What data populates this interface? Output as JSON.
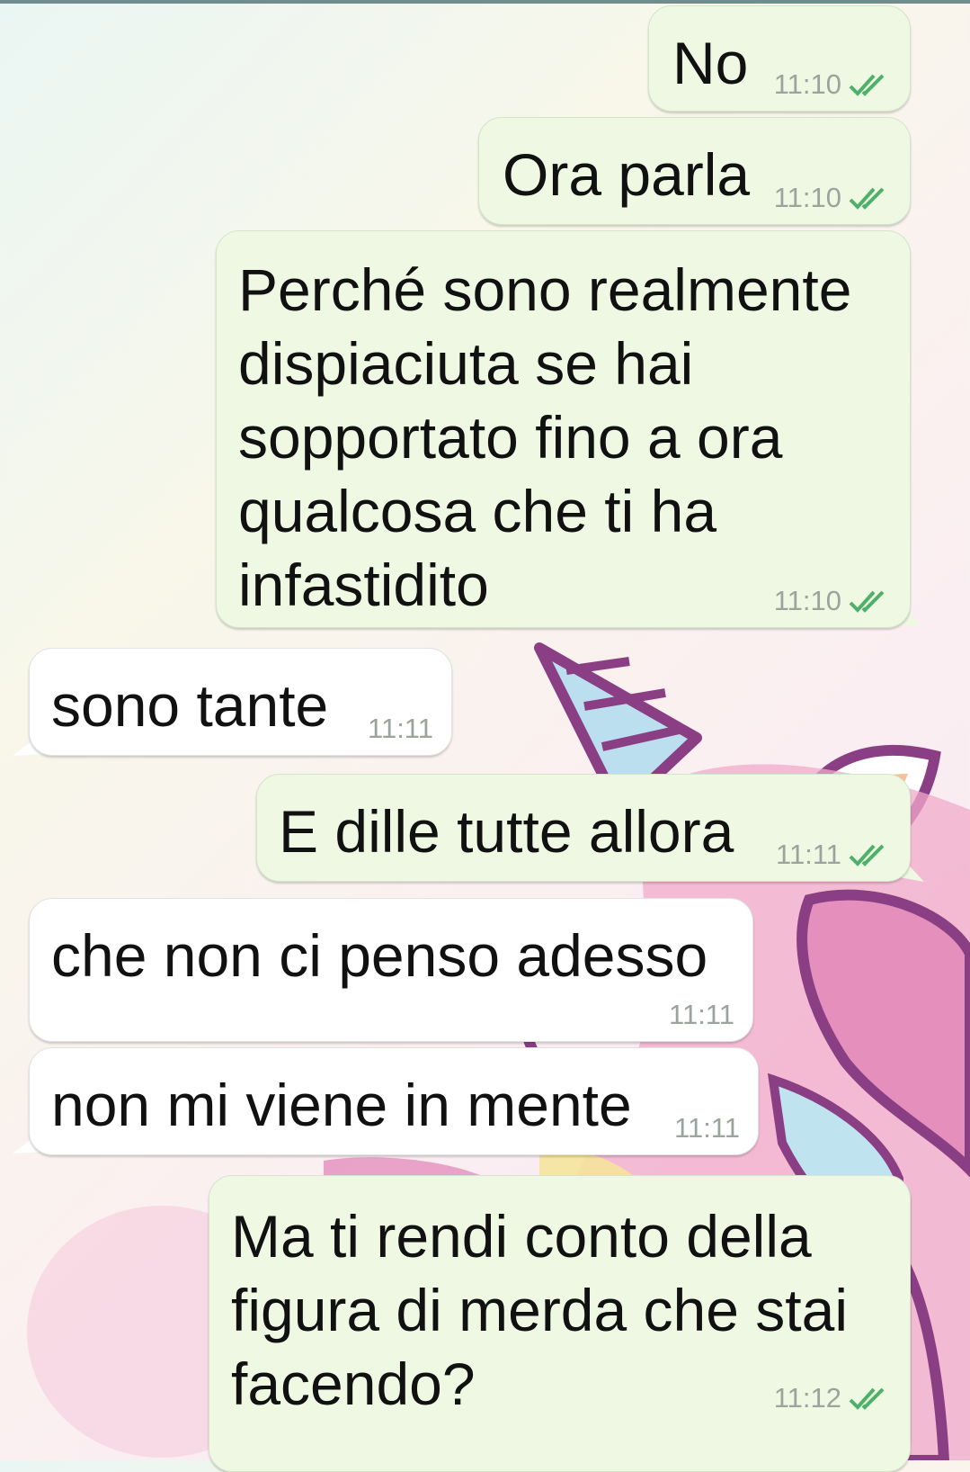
{
  "wallpaper": {
    "theme": "unicorn",
    "colors": {
      "horn_blue": "#bcdff0",
      "outline": "#8a3f84",
      "mane_pink": "#e58fbd",
      "ear_orange": "#f3c19a",
      "mane_yellow": "#f5e49c"
    }
  },
  "colors": {
    "outgoing_bubble": "#eef8e3",
    "incoming_bubble": "#ffffff",
    "timestamp": "#9aa39c",
    "read_ticks": "#4fb06a"
  },
  "messages": [
    {
      "direction": "outgoing",
      "text": "No",
      "time": "11:10",
      "status": "read-ticks-icon"
    },
    {
      "direction": "outgoing",
      "text": "Ora parla",
      "time": "11:10",
      "status": "read-ticks-icon"
    },
    {
      "direction": "outgoing",
      "lines": [
        "Perché sono realmente",
        "dispiaciuta se hai",
        "sopportato fino a ora",
        "qualcosa che ti ha",
        "infastidito"
      ],
      "time": "11:10",
      "status": "read-ticks-icon"
    },
    {
      "direction": "incoming",
      "text": "sono tante",
      "time": "11:11"
    },
    {
      "direction": "outgoing",
      "text": "E dille tutte allora",
      "time": "11:11",
      "status": "read-ticks-icon"
    },
    {
      "direction": "incoming",
      "text": "che non ci penso adesso",
      "time": "11:11"
    },
    {
      "direction": "incoming",
      "text": "non mi viene in mente",
      "time": "11:11"
    },
    {
      "direction": "outgoing",
      "lines": [
        "Ma ti rendi conto della",
        "figura di merda che stai",
        "facendo?"
      ],
      "time": "11:12",
      "status": "read-ticks-icon"
    }
  ]
}
